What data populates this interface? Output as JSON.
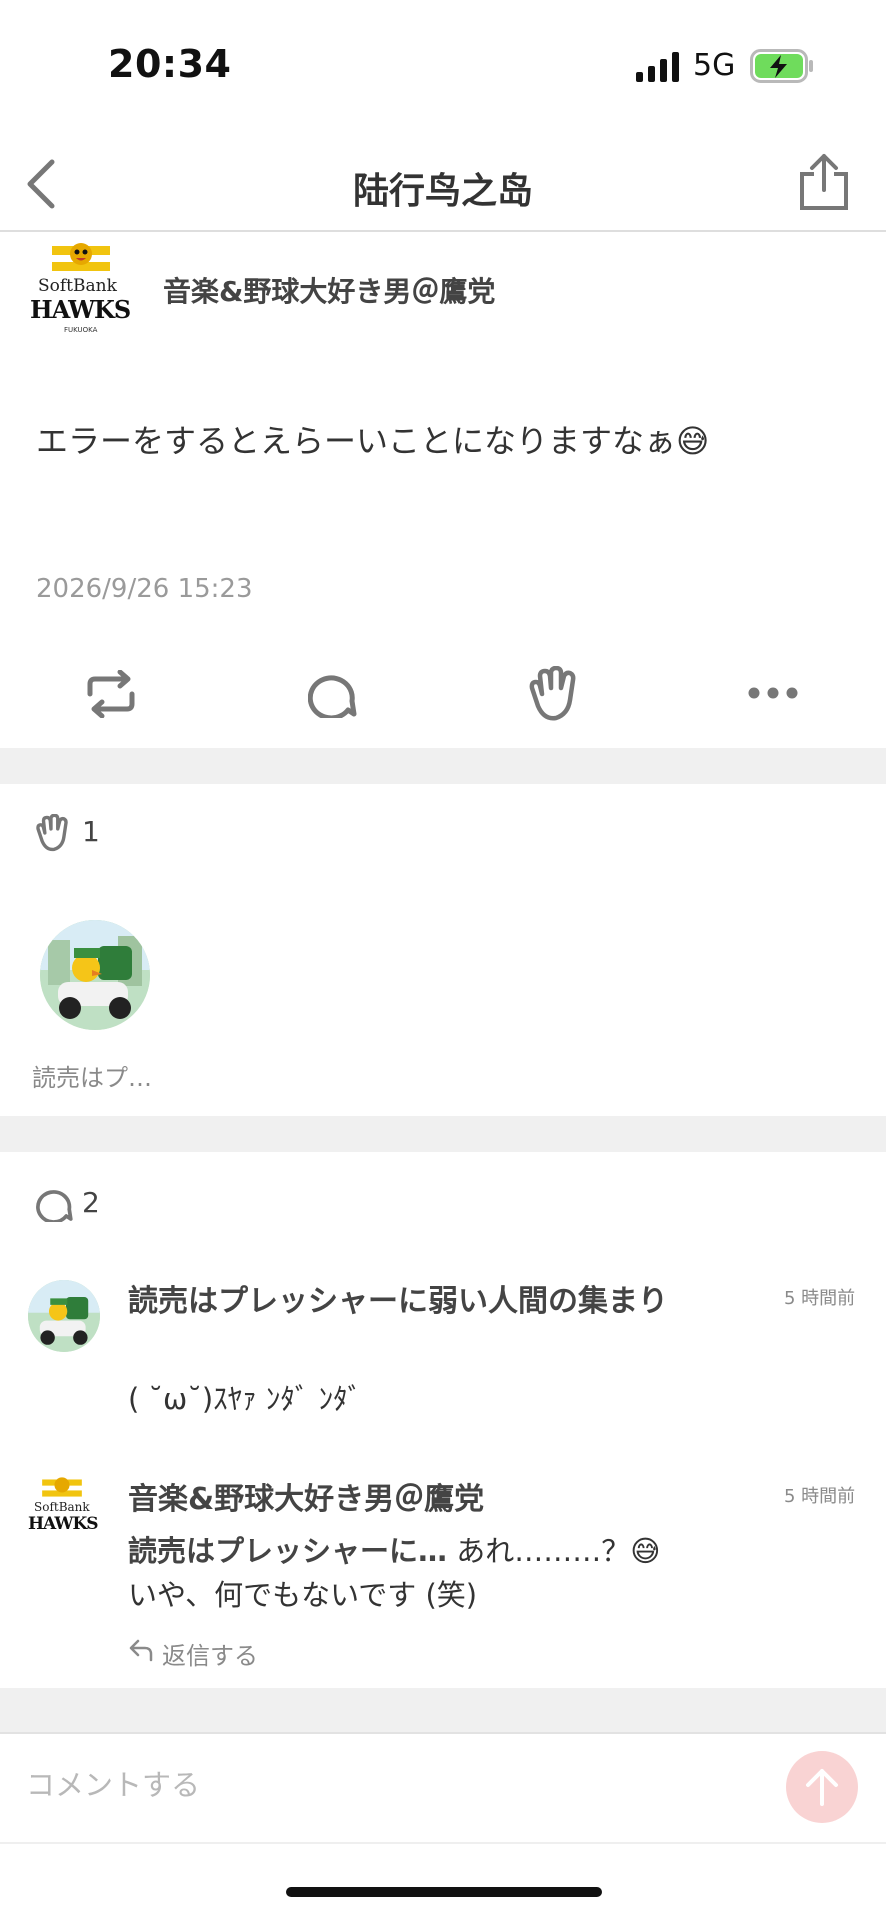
{
  "status_bar": {
    "time": "20:34",
    "network": "5G"
  },
  "nav": {
    "title": "陆行鸟之岛"
  },
  "post": {
    "author": "音楽&野球大好き男＠鷹党",
    "logo_text_1": "SoftBank",
    "logo_text_2": "HAWKS",
    "logo_text_3": "FUKUOKA",
    "body": "エラーをするとえらーいことになりますなぁ😅",
    "date": "2026/9/26 15:23"
  },
  "likes": {
    "count": "1",
    "users": [
      {
        "name": "読売はプ…"
      }
    ]
  },
  "comments_section": {
    "count": "2",
    "items": [
      {
        "author": "読売はプレッシャーに弱い人間の集まり",
        "time": "5 時間前",
        "text": "( ˘ω˘)ｽﾔｧ ﾝﾀﾞ ﾝﾀﾞ"
      },
      {
        "author": "音楽&野球大好き男＠鷹党",
        "time": "5 時間前",
        "quote": "読売はプレッシャーに…",
        "text_line1": " あれ………？😅",
        "text_line2": "いや、何でもないです (笑)",
        "reply_label": "返信する"
      }
    ]
  },
  "comment_box": {
    "placeholder": "コメントする"
  },
  "colors": {
    "accent": "#f9d3d3",
    "battery_fill": "#6fdc5c",
    "divider": "#f0f0f0"
  },
  "icons": [
    "back-icon",
    "share-icon",
    "repost-icon",
    "comment-icon",
    "glove-icon",
    "more-icon",
    "reply-icon",
    "arrow-up-icon",
    "signal-icon",
    "battery-icon"
  ]
}
